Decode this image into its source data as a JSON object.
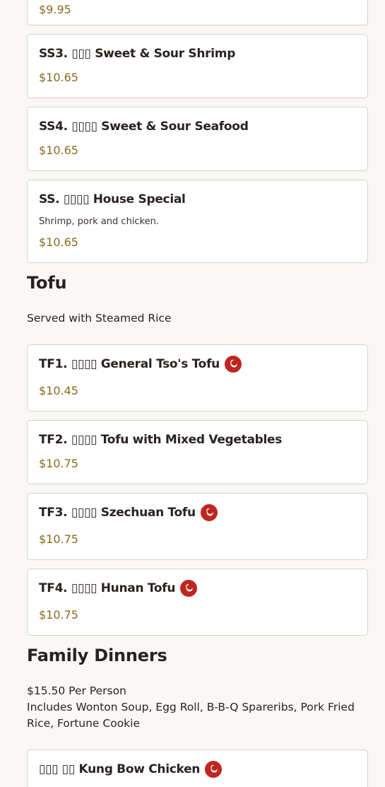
{
  "menu": {
    "top_card": {
      "price": "$9.95"
    },
    "cards": [
      {
        "name": "SS3. ▯▯▯ Sweet & Sour Shrimp",
        "price": "$10.65",
        "spicy": false
      },
      {
        "name": "SS4. ▯▯▯▯ Sweet & Sour Seafood",
        "price": "$10.65",
        "spicy": false
      },
      {
        "name": "SS. ▯▯▯▯ House Special",
        "description": "Shrimp, pork and chicken.",
        "price": "$10.65",
        "spicy": false
      }
    ],
    "tofu": {
      "title": "Tofu",
      "note": "Served with Steamed Rice",
      "items": [
        {
          "name": "TF1. ▯▯▯▯ General Tso's Tofu",
          "price": "$10.45",
          "spicy": true
        },
        {
          "name": "TF2. ▯▯▯▯ Tofu with Mixed Vegetables",
          "price": "$10.75",
          "spicy": false
        },
        {
          "name": "TF3. ▯▯▯▯ Szechuan Tofu",
          "price": "$10.75",
          "spicy": true
        },
        {
          "name": "TF4. ▯▯▯▯ Hunan Tofu",
          "price": "$10.75",
          "spicy": true
        }
      ]
    },
    "family": {
      "title": "Family Dinners",
      "price_line": "$15.50 Per Person",
      "includes_line": "Includes Wonton Soup, Egg Roll, B-B-Q Spareribs, Pork Fried Rice, Fortune Cookie",
      "items": [
        {
          "name": "▯▯▯ ▯▯ Kung Bow Chicken",
          "spicy": true
        }
      ]
    }
  },
  "icons": {
    "spicy": "spicy-pepper-icon"
  },
  "colors": {
    "price": "#8a6a1c",
    "spicy_icon": "#c0261f",
    "card_border": "#d6d2cc",
    "background": "#faf8f4"
  }
}
